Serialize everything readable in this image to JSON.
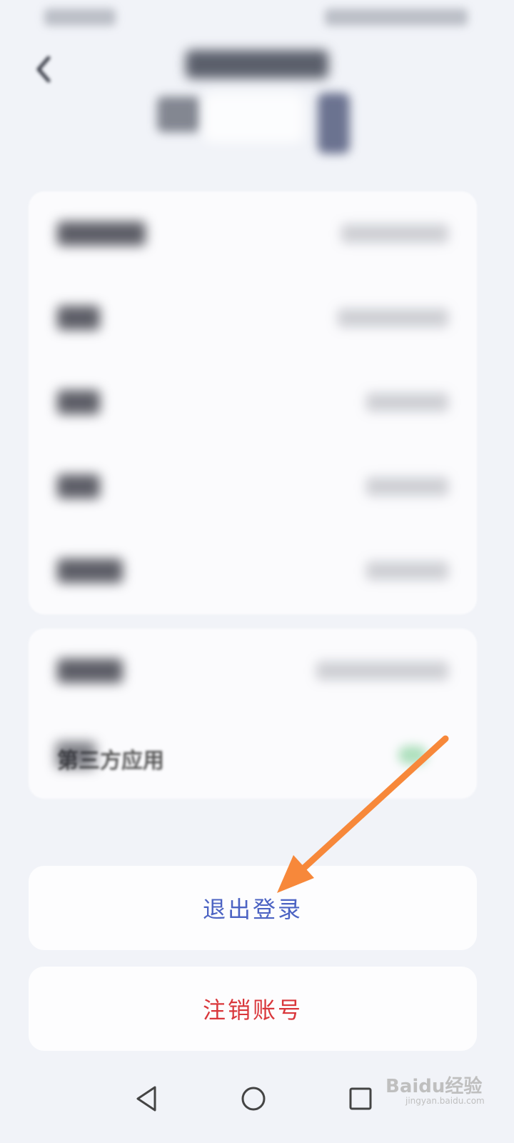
{
  "colors": {
    "background": "#f1f3f8",
    "card": "#fbfbfd",
    "logout_text": "#4c63c3",
    "cancel_text": "#d9373b",
    "annotation_arrow": "#f7883a"
  },
  "settings": {
    "third_party_row": {
      "label": "第三方应用"
    }
  },
  "actions": {
    "logout_label": "退出登录",
    "cancel_account_label": "注销账号"
  },
  "navigation": {
    "back_icon": "triangle-back-icon",
    "home_icon": "circle-home-icon",
    "recent_icon": "square-recent-icon"
  },
  "watermark": {
    "logo_text": "Baidu经验",
    "url_text": "jingyan.baidu.com"
  }
}
